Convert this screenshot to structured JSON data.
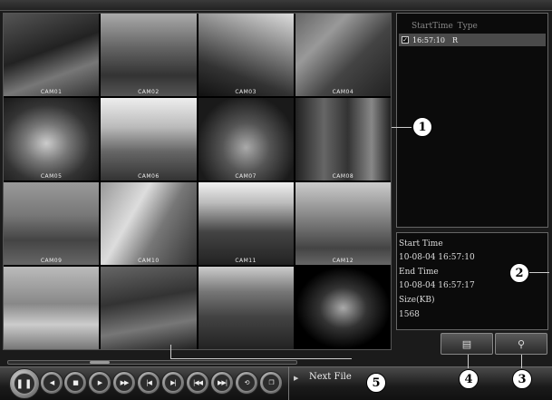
{
  "cameras": [
    {
      "label": "CAM01"
    },
    {
      "label": "CAM02"
    },
    {
      "label": "CAM03"
    },
    {
      "label": "CAM04"
    },
    {
      "label": "CAM05"
    },
    {
      "label": "CAM06"
    },
    {
      "label": "CAM07"
    },
    {
      "label": "CAM08"
    },
    {
      "label": "CAM09"
    },
    {
      "label": "CAM10"
    },
    {
      "label": "CAM11"
    },
    {
      "label": "CAM12"
    },
    {
      "label": ""
    },
    {
      "label": ""
    },
    {
      "label": ""
    },
    {
      "label": ""
    }
  ],
  "file_list": {
    "header": "StartTime Type",
    "rows": [
      {
        "time": "16:57:10",
        "type": "R",
        "checked": true
      }
    ]
  },
  "file_info": {
    "start_label": "Start Time",
    "start_value": "10-08-04 16:57:10",
    "end_label": "End Time",
    "end_value": "10-08-04 16:57:17",
    "size_label": "Size(KB)",
    "size_value": "1568"
  },
  "tools": {
    "backup_icon": "backup-icon",
    "search_icon": "magnifier-icon"
  },
  "playback": {
    "pause_icon": "pause-icon",
    "buttons": [
      "play-reverse-icon",
      "stop-icon",
      "play-icon",
      "fast-forward-icon",
      "previous-frame-icon",
      "next-frame-icon",
      "slow-rewind-icon",
      "slow-forward-icon",
      "repeat-icon",
      "fullscreen-icon"
    ]
  },
  "next_file": {
    "label": "Next File"
  },
  "callouts": [
    "1",
    "2",
    "3",
    "4",
    "5"
  ]
}
